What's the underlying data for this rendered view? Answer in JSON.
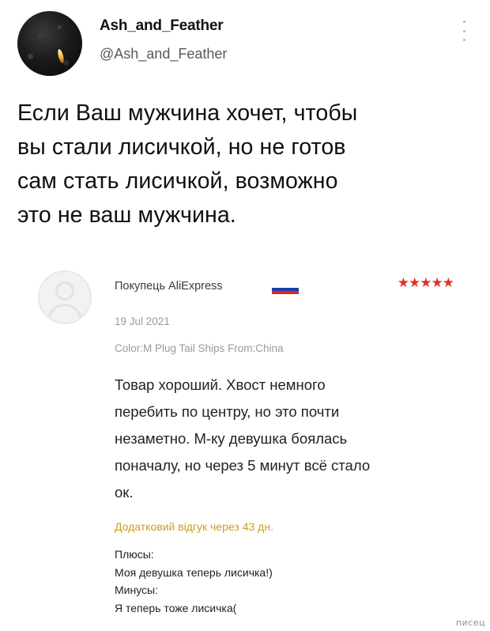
{
  "tweet": {
    "display_name": "Ash_and_Feather",
    "handle": "@Ash_and_Feather",
    "more_icon": "more-vertical-icon",
    "lines": [
      "Если Ваш мужчина хочет, чтобы",
      "вы стали лисичкой, но не готов",
      "сам стать лисичкой, возможно",
      "это не ваш мужчина."
    ]
  },
  "review": {
    "reviewer_name": "Покупець AliExpress",
    "flag_colors": [
      "#ffffff",
      "#1f3fa8",
      "#d52b1e"
    ],
    "rating": "★★★★★",
    "rating_value": 5,
    "star_color": "#e0322a",
    "date": "19 Jul 2021",
    "sku": "Color:M Plug Tail Ships From:China",
    "body_lines": [
      "Товар хороший. Хвост немного",
      "перебить по центру, но это почти",
      "незаметно. М-ку девушка боялась",
      "поначалу, но через 5 минут всё стало",
      "ок."
    ],
    "additional_title": "Додатковий відгук через 43 дн.",
    "additional_title_color": "#cf9d1a",
    "additional_lines": [
      "Плюсы:",
      "Моя девушка теперь лисичка!)",
      "Минусы:",
      "Я теперь тоже лисичка("
    ]
  },
  "watermark": "писец"
}
